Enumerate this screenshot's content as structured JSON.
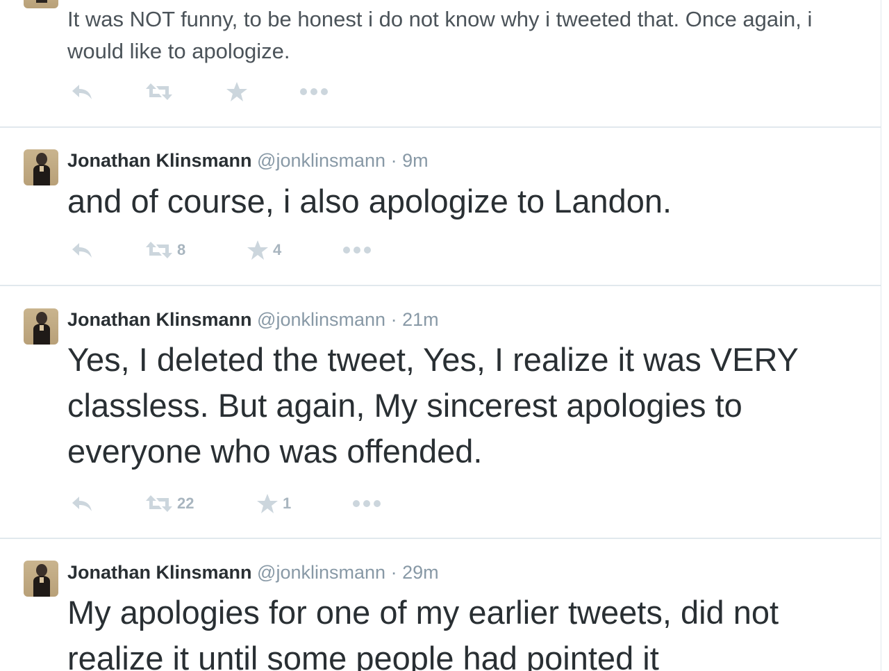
{
  "tweets": [
    {
      "text": "It was NOT funny, to be honest i do not know why i tweeted that. Once again, i would like to apologize.",
      "actions": {
        "reply": "",
        "retweets": "",
        "favorites": "",
        "more": ""
      }
    },
    {
      "name": "Jonathan Klinsmann",
      "handle": "@jonklinsmann",
      "separator": "·",
      "time": "9m",
      "text": "and of course, i also apologize to Landon.",
      "actions": {
        "retweets": "8",
        "favorites": "4"
      }
    },
    {
      "name": "Jonathan Klinsmann",
      "handle": "@jonklinsmann",
      "separator": "·",
      "time": "21m",
      "text": "Yes, I deleted the tweet, Yes, I realize it was VERY classless. But again, My sincerest apologies to everyone who was offended.",
      "actions": {
        "retweets": "22",
        "favorites": "1"
      }
    },
    {
      "name": "Jonathan Klinsmann",
      "handle": "@jonklinsmann",
      "separator": "·",
      "time": "29m",
      "text": "My apologies for one of my earlier tweets, did not realize it until some people had pointed it"
    }
  ],
  "icons": {
    "reply": "reply-icon",
    "retweet": "retweet-icon",
    "favorite": "star-icon",
    "more": "more-icon"
  },
  "colors": {
    "name": "#292f33",
    "meta": "#8899a6",
    "action_icon": "#ccd6dd",
    "divider": "#e1e8ed"
  }
}
